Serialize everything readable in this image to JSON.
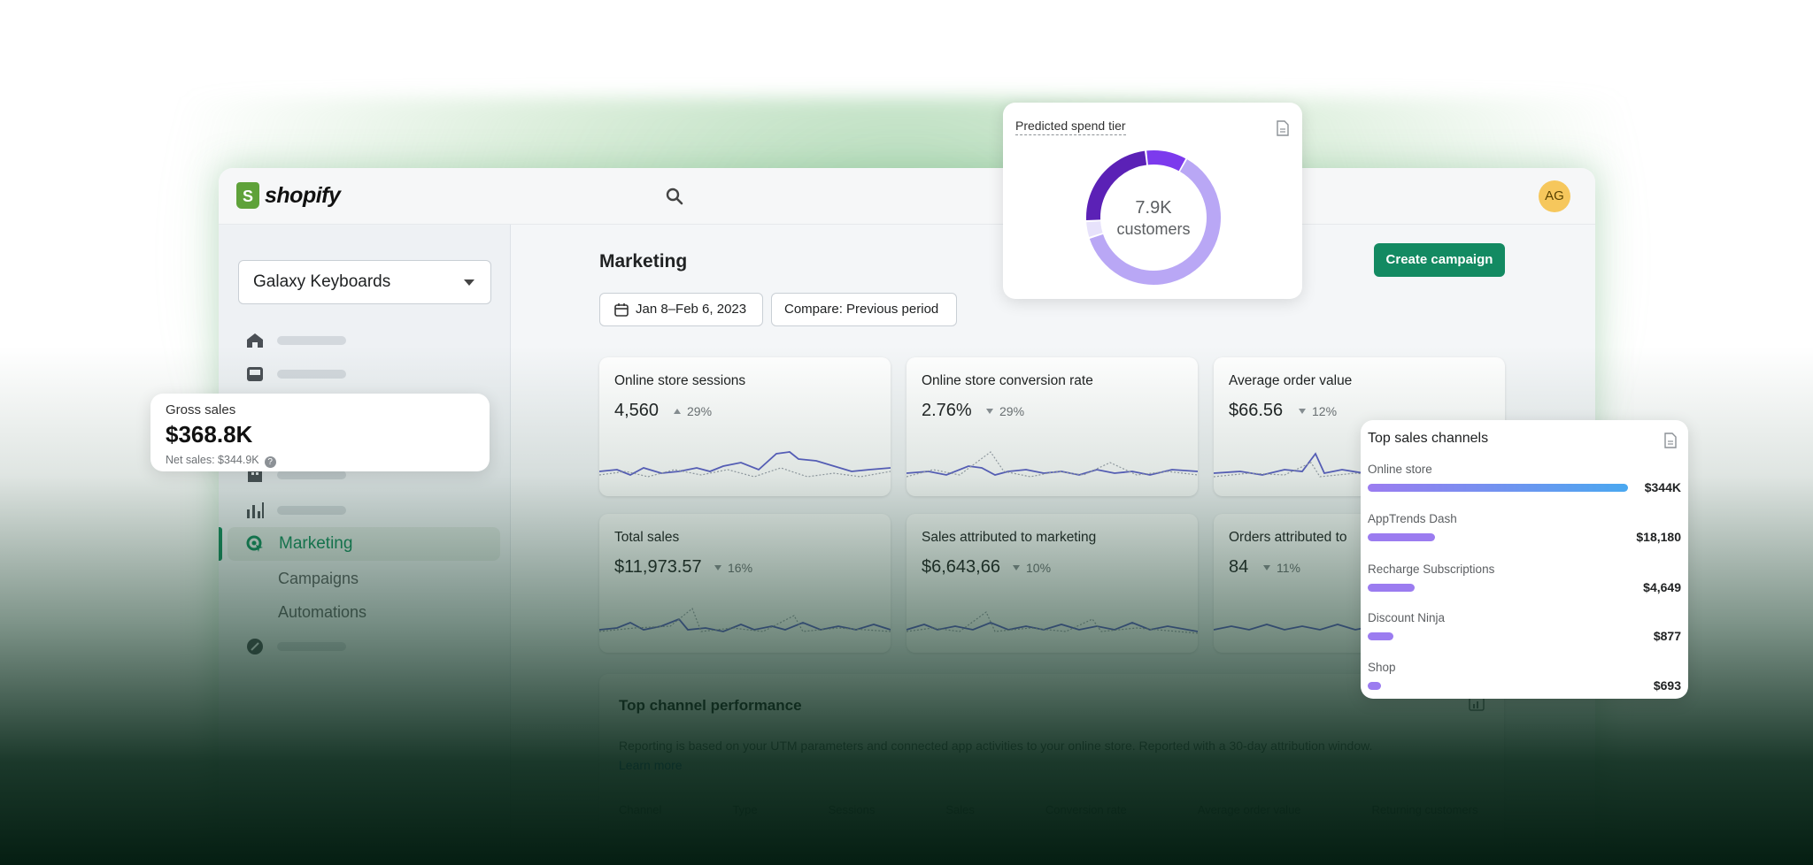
{
  "app": {
    "brand": "shopify",
    "avatar_initials": "AG",
    "store_name": "Galaxy Keyboards"
  },
  "sidebar": {
    "active_item": "Marketing",
    "sub_items": [
      "Campaigns",
      "Automations"
    ],
    "placeholder_items": [
      {
        "icon": "home-icon"
      },
      {
        "icon": "inbox-icon"
      },
      {
        "icon": "building-icon"
      },
      {
        "icon": "analytics-icon"
      },
      {
        "icon": "discount-icon"
      }
    ]
  },
  "page": {
    "title": "Marketing",
    "create_button": "Create campaign",
    "date_range": "Jan 8–Feb 6, 2023",
    "compare": "Compare: Previous period"
  },
  "metrics": [
    {
      "title": "Online store sessions",
      "value": "4,560",
      "delta": "29%",
      "direction": "up"
    },
    {
      "title": "Online store conversion rate",
      "value": "2.76%",
      "delta": "29%",
      "direction": "down"
    },
    {
      "title": "Average order value",
      "value": "$66.56",
      "delta": "12%",
      "direction": "down"
    },
    {
      "title": "Total sales",
      "value": "$11,973.57",
      "delta": "16%",
      "direction": "down"
    },
    {
      "title": "Sales attributed to marketing",
      "value": "$6,643,66",
      "delta": "10%",
      "direction": "down"
    },
    {
      "title": "Orders attributed to",
      "value": "84",
      "delta": "11%",
      "direction": "down"
    }
  ],
  "channel_performance": {
    "title": "Top channel performance",
    "description": "Reporting is based on your UTM parameters and connected app activities to your online store. Reported with a 30-day attribution window.",
    "link": "Learn more",
    "columns": [
      "Channel",
      "Type",
      "Sessions",
      "Sales",
      "Conversion rate",
      "Average order value",
      "Returning customers"
    ]
  },
  "gross_sales": {
    "label": "Gross sales",
    "value": "$368.8K",
    "net": "Net sales: $344.9K"
  },
  "spend_tier": {
    "title": "Predicted spend tier",
    "value": "7.9K",
    "unit": "customers",
    "segments": [
      {
        "fraction": 0.62,
        "color": "#b9a7f5"
      },
      {
        "fraction": 0.04,
        "color": "#e7e2fb"
      },
      {
        "fraction": 0.24,
        "color": "#5b21b6"
      },
      {
        "fraction": 0.1,
        "color": "#7c3aed"
      }
    ]
  },
  "top_channels": {
    "title": "Top sales channels",
    "max": 344000,
    "items": [
      {
        "name": "Online store",
        "value": "$344K",
        "amount": 344000,
        "gradient": true
      },
      {
        "name": "AppTrends Dash",
        "value": "$18,180",
        "amount": 18180
      },
      {
        "name": "Recharge Subscriptions",
        "value": "$4,649",
        "amount": 4649
      },
      {
        "name": "Discount Ninja",
        "value": "$877",
        "amount": 877
      },
      {
        "name": "Shop",
        "value": "$693",
        "amount": 693
      }
    ],
    "display_fraction": [
      1.0,
      0.26,
      0.18,
      0.1,
      0.05
    ]
  },
  "colors": {
    "accent": "#138a62",
    "chart_line": "#5b5fc7",
    "bar": "#9b7cf0"
  }
}
